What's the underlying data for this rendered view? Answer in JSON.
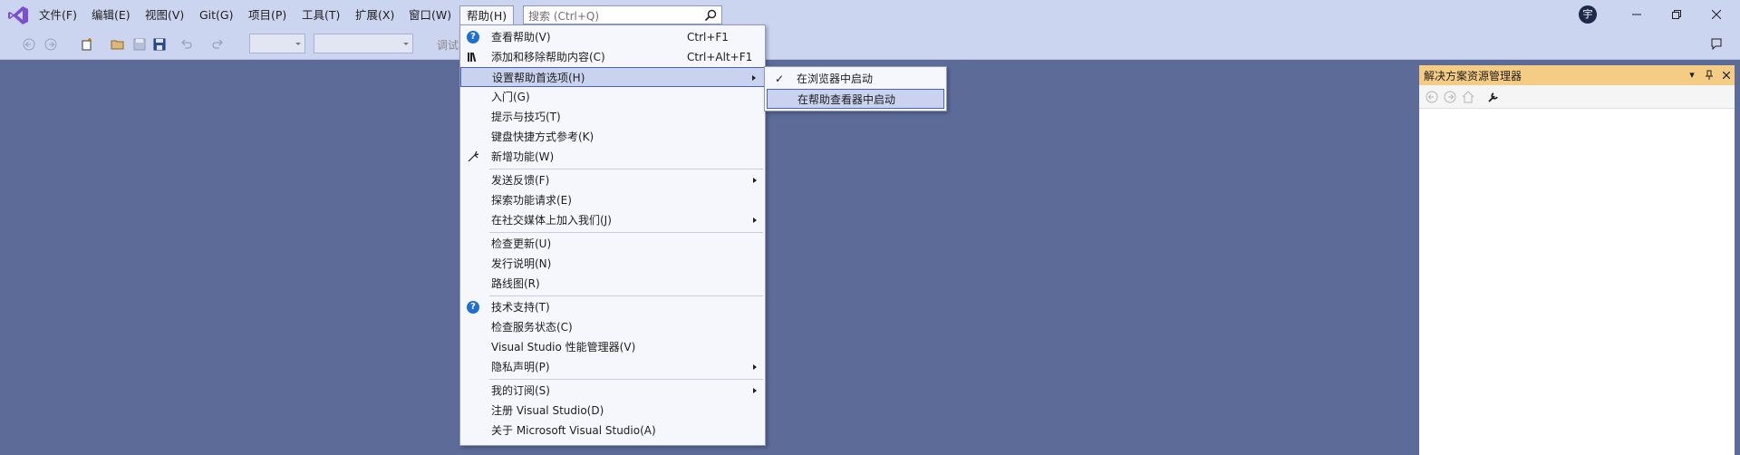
{
  "menubar": {
    "items": [
      "文件(F)",
      "编辑(E)",
      "视图(V)",
      "Git(G)",
      "项目(P)",
      "工具(T)",
      "扩展(X)",
      "窗口(W)",
      "帮助(H)"
    ],
    "search_placeholder": "搜索 (Ctrl+Q)",
    "avatar_initial": "宇"
  },
  "toolbar": {
    "debug_label": "调试"
  },
  "solution_explorer": {
    "title": "解决方案资源管理器"
  },
  "help_menu": {
    "items": [
      {
        "label": "查看帮助(V)",
        "shortcut": "Ctrl+F1",
        "icon": "help-icon"
      },
      {
        "label": "添加和移除帮助内容(C)",
        "shortcut": "Ctrl+Alt+F1",
        "icon": "books-icon"
      },
      {
        "label": "设置帮助首选项(H)",
        "submenu": true
      },
      {
        "label": "入门(G)"
      },
      {
        "label": "提示与技巧(T)"
      },
      {
        "label": "键盘快捷方式参考(K)"
      },
      {
        "label": "新增功能(W)",
        "icon": "sparkle-icon"
      },
      {
        "label": "发送反馈(F)",
        "submenu": true
      },
      {
        "label": "探索功能请求(E)"
      },
      {
        "label": "在社交媒体上加入我们(J)",
        "submenu": true
      },
      {
        "label": "检查更新(U)"
      },
      {
        "label": "发行说明(N)"
      },
      {
        "label": "路线图(R)"
      },
      {
        "label": "技术支持(T)",
        "icon": "help-icon"
      },
      {
        "label": "检查服务状态(C)"
      },
      {
        "label": "Visual Studio 性能管理器(V)"
      },
      {
        "label": "隐私声明(P)",
        "submenu": true
      },
      {
        "label": "我的订阅(S)",
        "submenu": true
      },
      {
        "label": "注册 Visual Studio(D)"
      },
      {
        "label": "关于 Microsoft Visual Studio(A)"
      }
    ]
  },
  "preferences_submenu": {
    "items": [
      {
        "label": "在浏览器中启动",
        "checked": true
      },
      {
        "label": "在帮助查看器中启动",
        "checked": false
      }
    ]
  },
  "colors": {
    "chrome": "#ccd5f0",
    "workspace": "#5d6b99",
    "panel_header": "#f5cc84",
    "highlight": "#c9d2ef"
  }
}
